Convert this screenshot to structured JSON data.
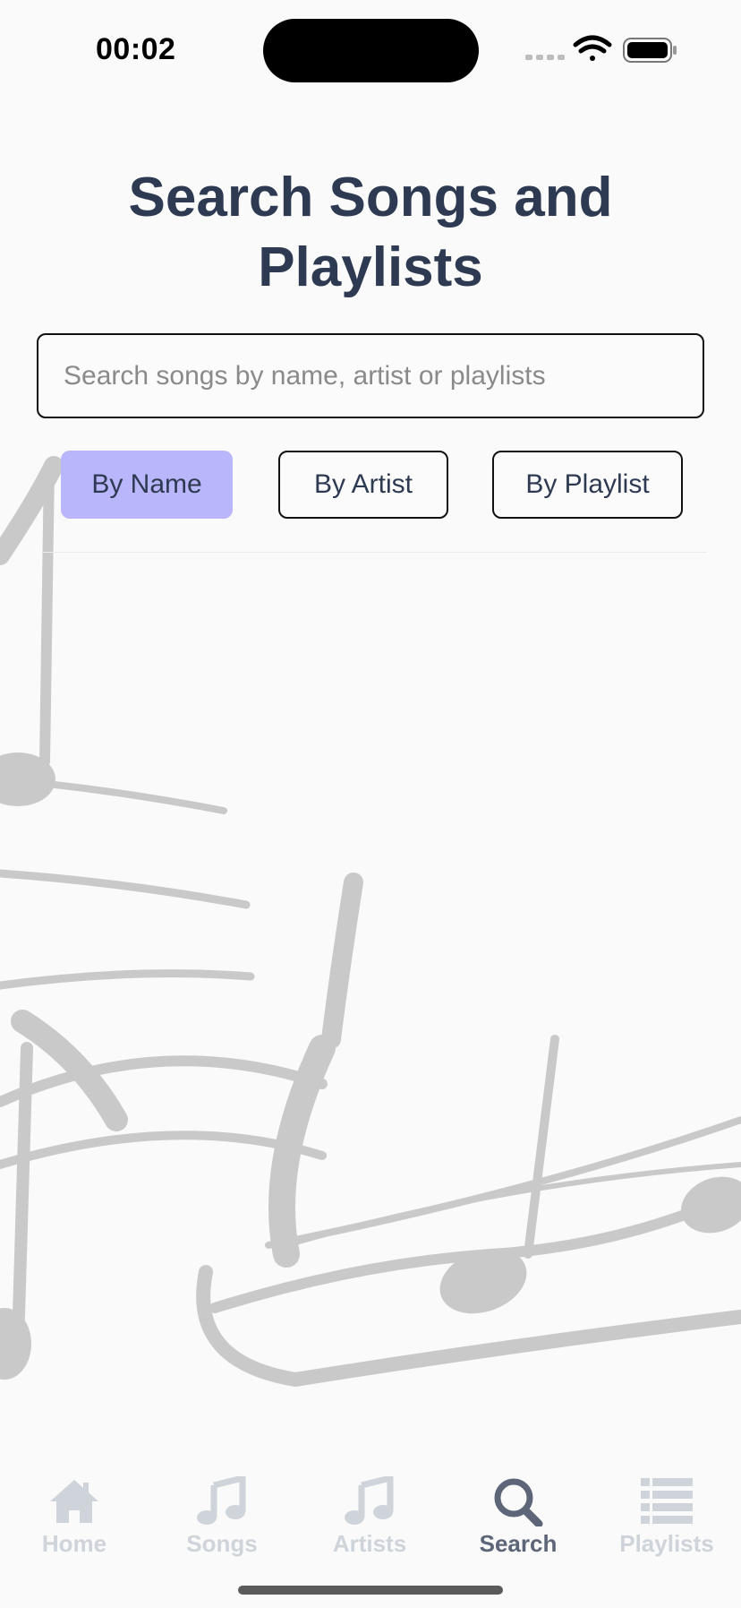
{
  "status_bar": {
    "time": "00:02"
  },
  "page": {
    "title": "Search Songs and Playlists"
  },
  "search": {
    "placeholder": "Search songs by name, artist or playlists",
    "value": ""
  },
  "filters": {
    "selected": "By Name",
    "items": [
      {
        "label": "By Name"
      },
      {
        "label": "By Artist"
      },
      {
        "label": "By Playlist"
      }
    ]
  },
  "tabbar": {
    "active": "Search",
    "items": [
      {
        "label": "Home",
        "icon": "home-icon"
      },
      {
        "label": "Songs",
        "icon": "music-note-icon"
      },
      {
        "label": "Artists",
        "icon": "music-note-icon"
      },
      {
        "label": "Search",
        "icon": "magnifier-icon"
      },
      {
        "label": "Playlists",
        "icon": "list-icon"
      }
    ]
  },
  "colors": {
    "title": "#2d3a52",
    "active_filter": "#b9b6fb",
    "tab_active": "#5d6579",
    "tab_inactive": "#cfd3da",
    "background_art": "#c9c9c9"
  }
}
